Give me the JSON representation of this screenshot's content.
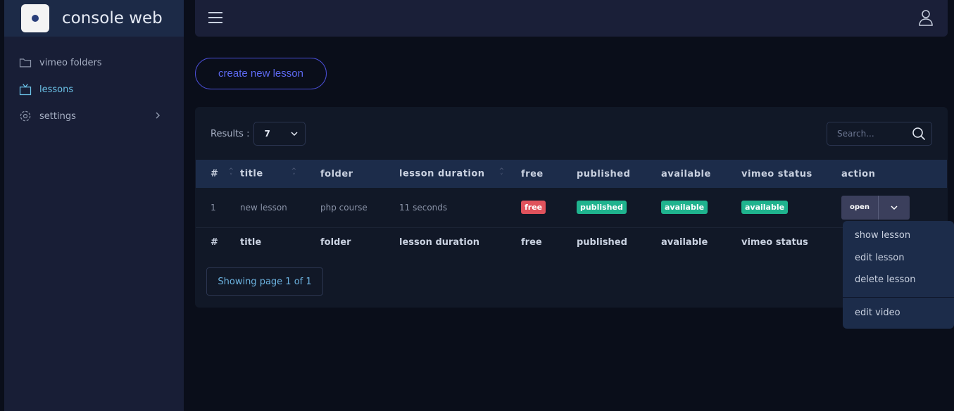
{
  "app": {
    "title": "console web"
  },
  "sidebar": {
    "items": [
      {
        "label": "vimeo folders",
        "icon": "folder-icon"
      },
      {
        "label": "lessons",
        "icon": "tv-icon"
      },
      {
        "label": "settings",
        "icon": "gear-icon"
      }
    ]
  },
  "actions": {
    "create": "create new lesson"
  },
  "table_controls": {
    "results_label": "Results :",
    "results_value": "7",
    "search_placeholder": "Search..."
  },
  "table": {
    "columns": [
      "#",
      "title",
      "folder",
      "lesson duration",
      "free",
      "published",
      "available",
      "vimeo status",
      "action"
    ],
    "rows": [
      {
        "num": "1",
        "title": "new lesson",
        "folder": "php course",
        "duration": "11 seconds",
        "free": "free",
        "published": "published",
        "available": "available",
        "vimeo_status": "available",
        "action": "open"
      }
    ],
    "footer": [
      "#",
      "title",
      "folder",
      "lesson duration",
      "free",
      "published",
      "available",
      "vimeo status"
    ]
  },
  "pagination": {
    "text": "Showing page 1 of 1"
  },
  "dropdown": {
    "items": [
      "show lesson",
      "edit lesson",
      "delete lesson",
      "edit video"
    ]
  },
  "colors": {
    "danger": "#e0525c",
    "success": "#1fb38e",
    "accent": "#5d69f0"
  }
}
